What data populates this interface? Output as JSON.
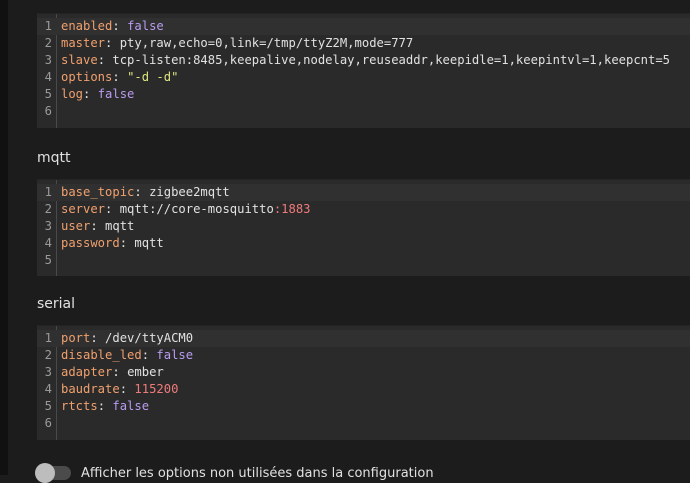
{
  "sections": [
    {
      "title": "",
      "lines": [
        {
          "num": "1",
          "key": "enabled",
          "value": "false",
          "vtype": "bool"
        },
        {
          "num": "2",
          "key": "master",
          "value": "pty,raw,echo=0,link=/tmp/ttyZ2M,mode=777",
          "vtype": "plain"
        },
        {
          "num": "3",
          "key": "slave",
          "value": "tcp-listen:8485,keepalive,nodelay,reuseaddr,keepidle=1,keepintvl=1,keepcnt=5",
          "vtype": "plain"
        },
        {
          "num": "4",
          "key": "options",
          "value": "\"-d -d\"",
          "vtype": "string"
        },
        {
          "num": "5",
          "key": "log",
          "value": "false",
          "vtype": "bool"
        },
        {
          "num": "6",
          "key": "",
          "value": "",
          "vtype": "plain"
        }
      ]
    },
    {
      "title": "mqtt",
      "lines": [
        {
          "num": "1",
          "key": "base_topic",
          "value": "zigbee2mqtt",
          "vtype": "plain"
        },
        {
          "num": "2",
          "key": "server",
          "value": "mqtt://core-mosquitto",
          "vtype": "plain",
          "suffix": ":1883"
        },
        {
          "num": "3",
          "key": "user",
          "value": "mqtt",
          "vtype": "plain"
        },
        {
          "num": "4",
          "key": "password",
          "value": "mqtt",
          "vtype": "plain"
        },
        {
          "num": "5",
          "key": "",
          "value": "",
          "vtype": "plain"
        }
      ]
    },
    {
      "title": "serial",
      "lines": [
        {
          "num": "1",
          "key": "port",
          "value": "/dev/ttyACM0",
          "vtype": "plain"
        },
        {
          "num": "2",
          "key": "disable_led",
          "value": "false",
          "vtype": "bool"
        },
        {
          "num": "3",
          "key": "adapter",
          "value": "ember",
          "vtype": "plain"
        },
        {
          "num": "4",
          "key": "baudrate",
          "value": "115200",
          "vtype": "number"
        },
        {
          "num": "5",
          "key": "rtcts",
          "value": "false",
          "vtype": "bool"
        },
        {
          "num": "6",
          "key": "",
          "value": "",
          "vtype": "plain"
        }
      ]
    }
  ],
  "toggle": {
    "label": "Afficher les options non utilisées dans la configuration",
    "checked": false
  }
}
